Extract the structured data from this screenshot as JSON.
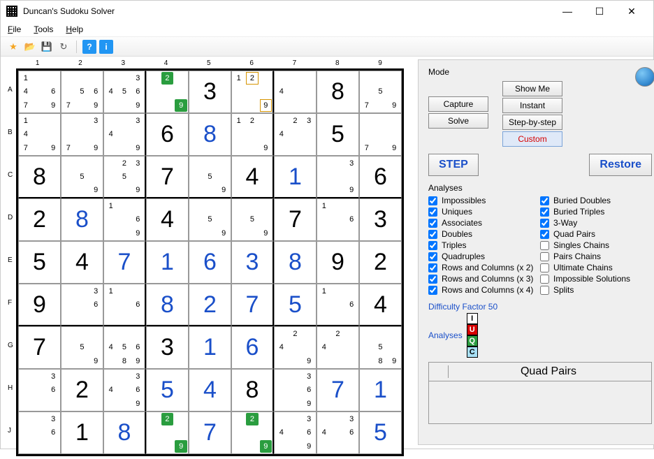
{
  "window": {
    "title": "Duncan's Sudoku Solver"
  },
  "menu": {
    "file": "File",
    "tools": "Tools",
    "help": "Help"
  },
  "col_labels": [
    "1",
    "2",
    "3",
    "4",
    "5",
    "6",
    "7",
    "8",
    "9"
  ],
  "row_labels": [
    "A",
    "B",
    "C",
    "D",
    "E",
    "F",
    "G",
    "H",
    "J"
  ],
  "grid": [
    [
      {
        "t": "c",
        "v": [
          "1",
          "",
          "",
          "4",
          "",
          "6",
          "7",
          "",
          "9"
        ]
      },
      {
        "t": "c",
        "v": [
          "",
          "",
          "",
          "",
          "5",
          "6",
          "7",
          "",
          "9"
        ]
      },
      {
        "t": "c",
        "v": [
          "",
          "",
          "3",
          "4",
          "5",
          "6",
          "",
          "",
          "9"
        ]
      },
      {
        "t": "c",
        "v": [
          "",
          "",
          "",
          "",
          "",
          "",
          "",
          "",
          "9"
        ],
        "hl": {
          "2": "green",
          "9": "green"
        }
      },
      {
        "t": "b",
        "v": "3",
        "s": "given"
      },
      {
        "t": "c",
        "v": [
          "1",
          "",
          "",
          "",
          "",
          "",
          "",
          "",
          "9"
        ],
        "hl": {
          "2": "orange",
          "9": "orange"
        }
      },
      {
        "t": "c",
        "v": [
          "",
          "",
          "",
          "4",
          "",
          "",
          "",
          "",
          ""
        ]
      },
      {
        "t": "b",
        "v": "8",
        "s": "given"
      },
      {
        "t": "c",
        "v": [
          "",
          "",
          "",
          "",
          "5",
          "",
          "7",
          "",
          "9"
        ]
      }
    ],
    [
      {
        "t": "c",
        "v": [
          "1",
          "",
          "",
          "4",
          "",
          "",
          "7",
          "",
          "9"
        ]
      },
      {
        "t": "c",
        "v": [
          "",
          "",
          "3",
          "",
          "",
          "",
          "7",
          "",
          "9"
        ]
      },
      {
        "t": "c",
        "v": [
          "",
          "",
          "3",
          "4",
          "",
          "",
          "",
          "",
          "9"
        ]
      },
      {
        "t": "b",
        "v": "6",
        "s": "given"
      },
      {
        "t": "b",
        "v": "8",
        "s": "solved"
      },
      {
        "t": "c",
        "v": [
          "1",
          "2",
          "",
          "",
          "",
          "",
          "",
          "",
          "9"
        ]
      },
      {
        "t": "c",
        "v": [
          "",
          "2",
          "3",
          "4",
          "",
          "",
          "",
          "",
          ""
        ]
      },
      {
        "t": "b",
        "v": "5",
        "s": "given"
      },
      {
        "t": "c",
        "v": [
          "",
          "",
          "",
          "",
          "",
          "",
          "7",
          "",
          "9"
        ]
      }
    ],
    [
      {
        "t": "b",
        "v": "8",
        "s": "given"
      },
      {
        "t": "c",
        "v": [
          "",
          "",
          "",
          "",
          "5",
          "",
          "",
          "",
          "9"
        ]
      },
      {
        "t": "c",
        "v": [
          "",
          "2",
          "3",
          "",
          "5",
          "",
          "",
          "",
          "9"
        ]
      },
      {
        "t": "b",
        "v": "7",
        "s": "given"
      },
      {
        "t": "c",
        "v": [
          "",
          "",
          "",
          "",
          "5",
          "",
          "",
          "",
          "9"
        ]
      },
      {
        "t": "b",
        "v": "4",
        "s": "given"
      },
      {
        "t": "b",
        "v": "1",
        "s": "solved"
      },
      {
        "t": "c",
        "v": [
          "",
          "",
          "3",
          "",
          "",
          "",
          "",
          "",
          "9"
        ]
      },
      {
        "t": "b",
        "v": "6",
        "s": "given"
      }
    ],
    [
      {
        "t": "b",
        "v": "2",
        "s": "given"
      },
      {
        "t": "b",
        "v": "8",
        "s": "solved"
      },
      {
        "t": "c",
        "v": [
          "1",
          "",
          "",
          "",
          "",
          "6",
          "",
          "",
          "9"
        ]
      },
      {
        "t": "b",
        "v": "4",
        "s": "given"
      },
      {
        "t": "c",
        "v": [
          "",
          "",
          "",
          "",
          "5",
          "",
          "",
          "",
          "9"
        ]
      },
      {
        "t": "c",
        "v": [
          "",
          "",
          "",
          "",
          "5",
          "",
          "",
          "",
          "9"
        ]
      },
      {
        "t": "b",
        "v": "7",
        "s": "given"
      },
      {
        "t": "c",
        "v": [
          "1",
          "",
          "",
          "",
          "",
          "6",
          "",
          "",
          ""
        ]
      },
      {
        "t": "b",
        "v": "3",
        "s": "given"
      }
    ],
    [
      {
        "t": "b",
        "v": "5",
        "s": "given"
      },
      {
        "t": "b",
        "v": "4",
        "s": "given"
      },
      {
        "t": "b",
        "v": "7",
        "s": "solved"
      },
      {
        "t": "b",
        "v": "1",
        "s": "solved"
      },
      {
        "t": "b",
        "v": "6",
        "s": "solved"
      },
      {
        "t": "b",
        "v": "3",
        "s": "solved"
      },
      {
        "t": "b",
        "v": "8",
        "s": "solved"
      },
      {
        "t": "b",
        "v": "9",
        "s": "given"
      },
      {
        "t": "b",
        "v": "2",
        "s": "given"
      }
    ],
    [
      {
        "t": "b",
        "v": "9",
        "s": "given"
      },
      {
        "t": "c",
        "v": [
          "",
          "",
          "3",
          "",
          "",
          "6",
          "",
          "",
          ""
        ]
      },
      {
        "t": "c",
        "v": [
          "1",
          "",
          "",
          "",
          "",
          "6",
          "",
          "",
          ""
        ]
      },
      {
        "t": "b",
        "v": "8",
        "s": "solved"
      },
      {
        "t": "b",
        "v": "2",
        "s": "solved"
      },
      {
        "t": "b",
        "v": "7",
        "s": "solved"
      },
      {
        "t": "b",
        "v": "5",
        "s": "solved"
      },
      {
        "t": "c",
        "v": [
          "1",
          "",
          "",
          "",
          "",
          "6",
          "",
          "",
          ""
        ]
      },
      {
        "t": "b",
        "v": "4",
        "s": "given"
      }
    ],
    [
      {
        "t": "b",
        "v": "7",
        "s": "given"
      },
      {
        "t": "c",
        "v": [
          "",
          "",
          "",
          "",
          "5",
          "",
          "",
          "",
          "9"
        ]
      },
      {
        "t": "c",
        "v": [
          "",
          "",
          "",
          "4",
          "5",
          "6",
          "",
          "8",
          "9"
        ]
      },
      {
        "t": "b",
        "v": "3",
        "s": "given"
      },
      {
        "t": "b",
        "v": "1",
        "s": "solved"
      },
      {
        "t": "b",
        "v": "6",
        "s": "solved"
      },
      {
        "t": "c",
        "v": [
          "",
          "2",
          "",
          "4",
          "",
          "",
          "",
          "",
          "9"
        ]
      },
      {
        "t": "c",
        "v": [
          "",
          "2",
          "",
          "4",
          "",
          "",
          "",
          "",
          ""
        ]
      },
      {
        "t": "c",
        "v": [
          "",
          "",
          "",
          "",
          "5",
          "",
          "",
          "8",
          "9"
        ]
      }
    ],
    [
      {
        "t": "c",
        "v": [
          "",
          "",
          "3",
          "",
          "",
          "6",
          "",
          "",
          ""
        ]
      },
      {
        "t": "b",
        "v": "2",
        "s": "given"
      },
      {
        "t": "c",
        "v": [
          "",
          "",
          "3",
          "4",
          "",
          "6",
          "",
          "",
          "9"
        ]
      },
      {
        "t": "b",
        "v": "5",
        "s": "solved"
      },
      {
        "t": "b",
        "v": "4",
        "s": "solved"
      },
      {
        "t": "b",
        "v": "8",
        "s": "given"
      },
      {
        "t": "c",
        "v": [
          "",
          "",
          "3",
          "",
          "",
          "6",
          "",
          "",
          "9"
        ]
      },
      {
        "t": "b",
        "v": "7",
        "s": "solved"
      },
      {
        "t": "b",
        "v": "1",
        "s": "solved"
      }
    ],
    [
      {
        "t": "c",
        "v": [
          "",
          "",
          "3",
          "",
          "",
          "6",
          "",
          "",
          ""
        ]
      },
      {
        "t": "b",
        "v": "1",
        "s": "given"
      },
      {
        "t": "b",
        "v": "8",
        "s": "solved"
      },
      {
        "t": "c",
        "v": [
          "",
          "",
          "",
          "",
          "",
          "",
          "",
          "",
          "9"
        ],
        "hl": {
          "2": "green",
          "9": "green"
        }
      },
      {
        "t": "b",
        "v": "7",
        "s": "solved"
      },
      {
        "t": "c",
        "v": [
          "",
          "",
          "",
          "",
          "",
          "",
          "",
          "",
          "9"
        ],
        "hl": {
          "2": "green",
          "9": "green"
        }
      },
      {
        "t": "c",
        "v": [
          "",
          "",
          "3",
          "4",
          "",
          "6",
          "",
          "",
          "9"
        ]
      },
      {
        "t": "c",
        "v": [
          "",
          "",
          "3",
          "4",
          "",
          "6",
          "",
          "",
          ""
        ]
      },
      {
        "t": "b",
        "v": "5",
        "s": "solved"
      }
    ]
  ],
  "panel": {
    "mode_label": "Mode",
    "capture": "Capture",
    "solve": "Solve",
    "show_me": "Show Me",
    "instant": "Instant",
    "step_by_step": "Step-by-step",
    "custom": "Custom",
    "step": "STEP",
    "restore": "Restore",
    "analyses_label": "Analyses",
    "checks_left": [
      {
        "label": "Impossibles",
        "checked": true
      },
      {
        "label": "Uniques",
        "checked": true
      },
      {
        "label": "Associates",
        "checked": true
      },
      {
        "label": "Doubles",
        "checked": true
      },
      {
        "label": "Triples",
        "checked": true
      },
      {
        "label": "Quadruples",
        "checked": true
      },
      {
        "label": "Rows and Columns (x 2)",
        "checked": true
      },
      {
        "label": "Rows and Columns (x 3)",
        "checked": true
      },
      {
        "label": "Rows and Columns (x 4)",
        "checked": true
      }
    ],
    "checks_right": [
      {
        "label": "Buried Doubles",
        "checked": true
      },
      {
        "label": "Buried Triples",
        "checked": true
      },
      {
        "label": "3-Way",
        "checked": true
      },
      {
        "label": "Quad Pairs",
        "checked": true
      },
      {
        "label": "Singles Chains",
        "checked": false
      },
      {
        "label": "Pairs Chains",
        "checked": false
      },
      {
        "label": "Ultimate Chains",
        "checked": false
      },
      {
        "label": "Impossible Solutions",
        "checked": false
      },
      {
        "label": "Splits",
        "checked": false
      }
    ],
    "difficulty": "Difficulty Factor 50",
    "an_label": "Analyses",
    "badges": [
      "I",
      "U",
      "Q",
      "C"
    ],
    "result": "Quad Pairs"
  }
}
